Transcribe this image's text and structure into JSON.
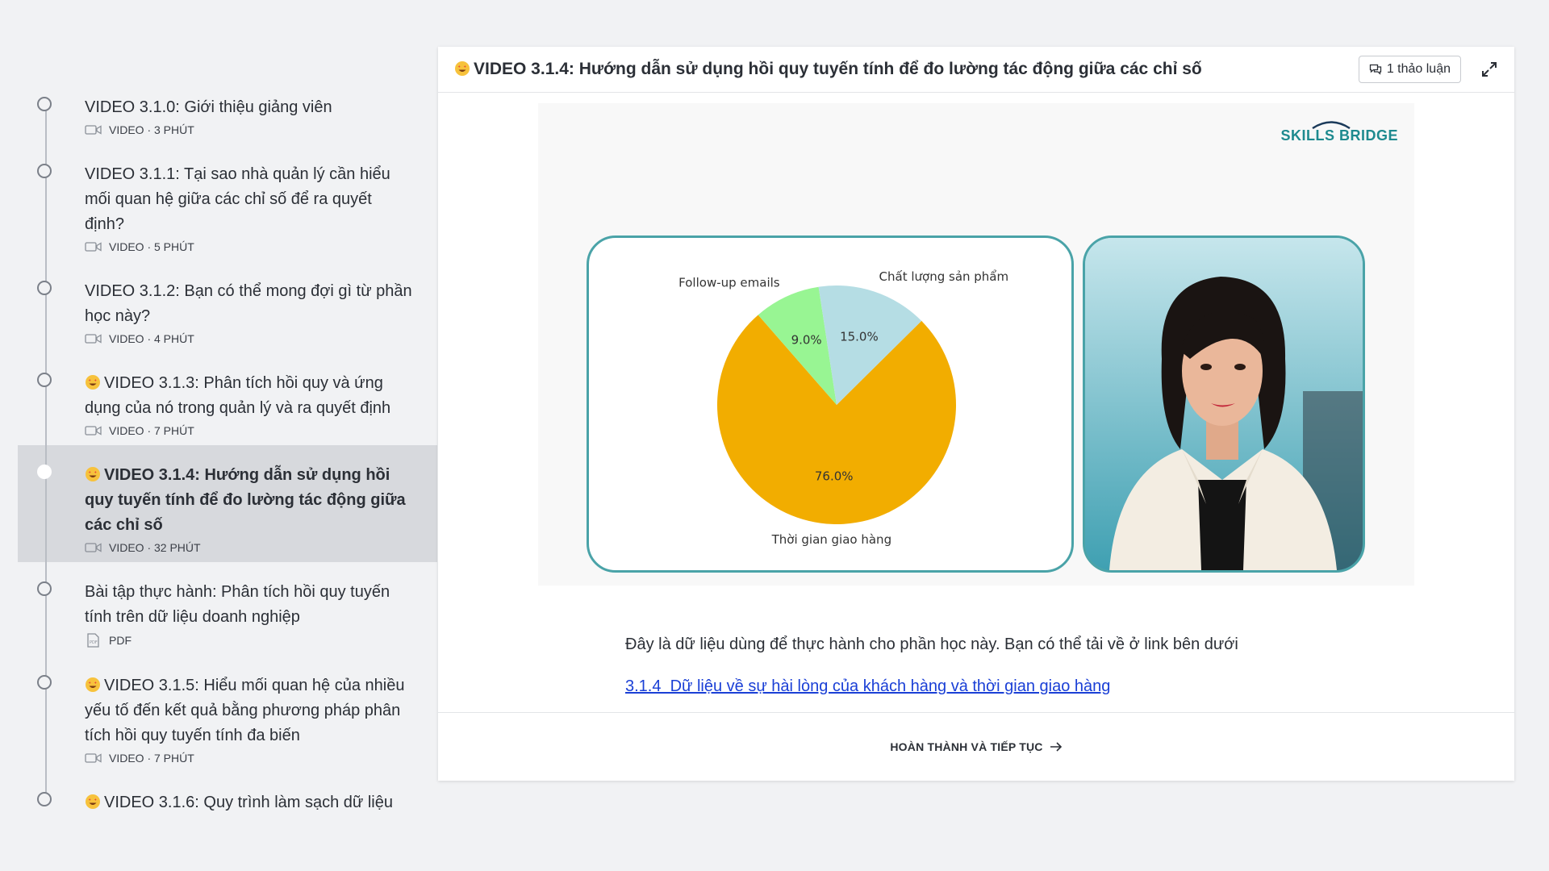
{
  "sidebar": {
    "items": [
      {
        "title": "VIDEO 3.1.0: Giới thiệu giảng viên",
        "meta": "VIDEO · 3 PHÚT",
        "emoji": false,
        "type": "video",
        "active": false
      },
      {
        "title": "VIDEO 3.1.1: Tại sao nhà quản lý cần hiểu mối quan hệ giữa các chỉ số để ra quyết định?",
        "meta": "VIDEO · 5 PHÚT",
        "emoji": false,
        "type": "video",
        "active": false
      },
      {
        "title": "VIDEO 3.1.2: Bạn có thể mong đợi gì từ phần học này?",
        "meta": "VIDEO · 4 PHÚT",
        "emoji": false,
        "type": "video",
        "active": false
      },
      {
        "title": "VIDEO 3.1.3: Phân tích hồi quy và ứng dụng của nó trong quản lý và ra quyết định",
        "meta": "VIDEO · 7 PHÚT",
        "emoji": true,
        "type": "video",
        "active": false
      },
      {
        "title": "VIDEO 3.1.4: Hướng dẫn sử dụng hồi quy tuyến tính để đo lường tác động giữa các chỉ số",
        "meta": "VIDEO · 32 PHÚT",
        "emoji": true,
        "type": "video",
        "active": true
      },
      {
        "title": "Bài tập thực hành: Phân tích hồi quy tuyến tính trên dữ liệu doanh nghiệp",
        "meta": "PDF",
        "emoji": false,
        "type": "pdf",
        "active": false
      },
      {
        "title": "VIDEO 3.1.5: Hiểu mối quan hệ của nhiều yếu tố đến kết quả bằng phương pháp phân tích hồi quy tuyến tính đa biến",
        "meta": "VIDEO · 7 PHÚT",
        "emoji": true,
        "type": "video",
        "active": false
      },
      {
        "title": "VIDEO 3.1.6: Quy trình làm sạch dữ liệu",
        "meta": "",
        "emoji": true,
        "type": "video",
        "active": false
      }
    ]
  },
  "header": {
    "title": "VIDEO 3.1.4: Hướng dẫn sử dụng hồi quy tuyến tính để đo lường tác động giữa các chỉ số",
    "discussion_label": "1 thảo luận",
    "expand_icon": "expand-icon",
    "chat_icon": "chat-bubble-icon"
  },
  "video": {
    "brand": "SKILLS BRIDGE",
    "brand_color": "#1e8a8f",
    "frame_color": "#4aa3a8"
  },
  "chart_data": {
    "type": "pie",
    "labels": [
      "Thời gian giao hàng",
      "Follow-up emails",
      "Chất lượng sản phẩm"
    ],
    "values": [
      76.0,
      9.0,
      15.0
    ],
    "value_labels": [
      "76.0%",
      "9.0%",
      "15.0%"
    ],
    "colors": [
      "#f2ad00",
      "#98f593",
      "#b5dde4"
    ],
    "title": ""
  },
  "content": {
    "note": "Đây là dữ liệu dùng để thực hành cho phần học này. Bạn có thể tải về ở link bên dưới",
    "link_text": "3.1.4  Dữ liệu về sự hài lòng của khách hàng và thời gian giao hàng"
  },
  "footer": {
    "next_label": "HOÀN THÀNH VÀ TIẾP TỤC",
    "next_icon": "arrow-right-icon"
  }
}
